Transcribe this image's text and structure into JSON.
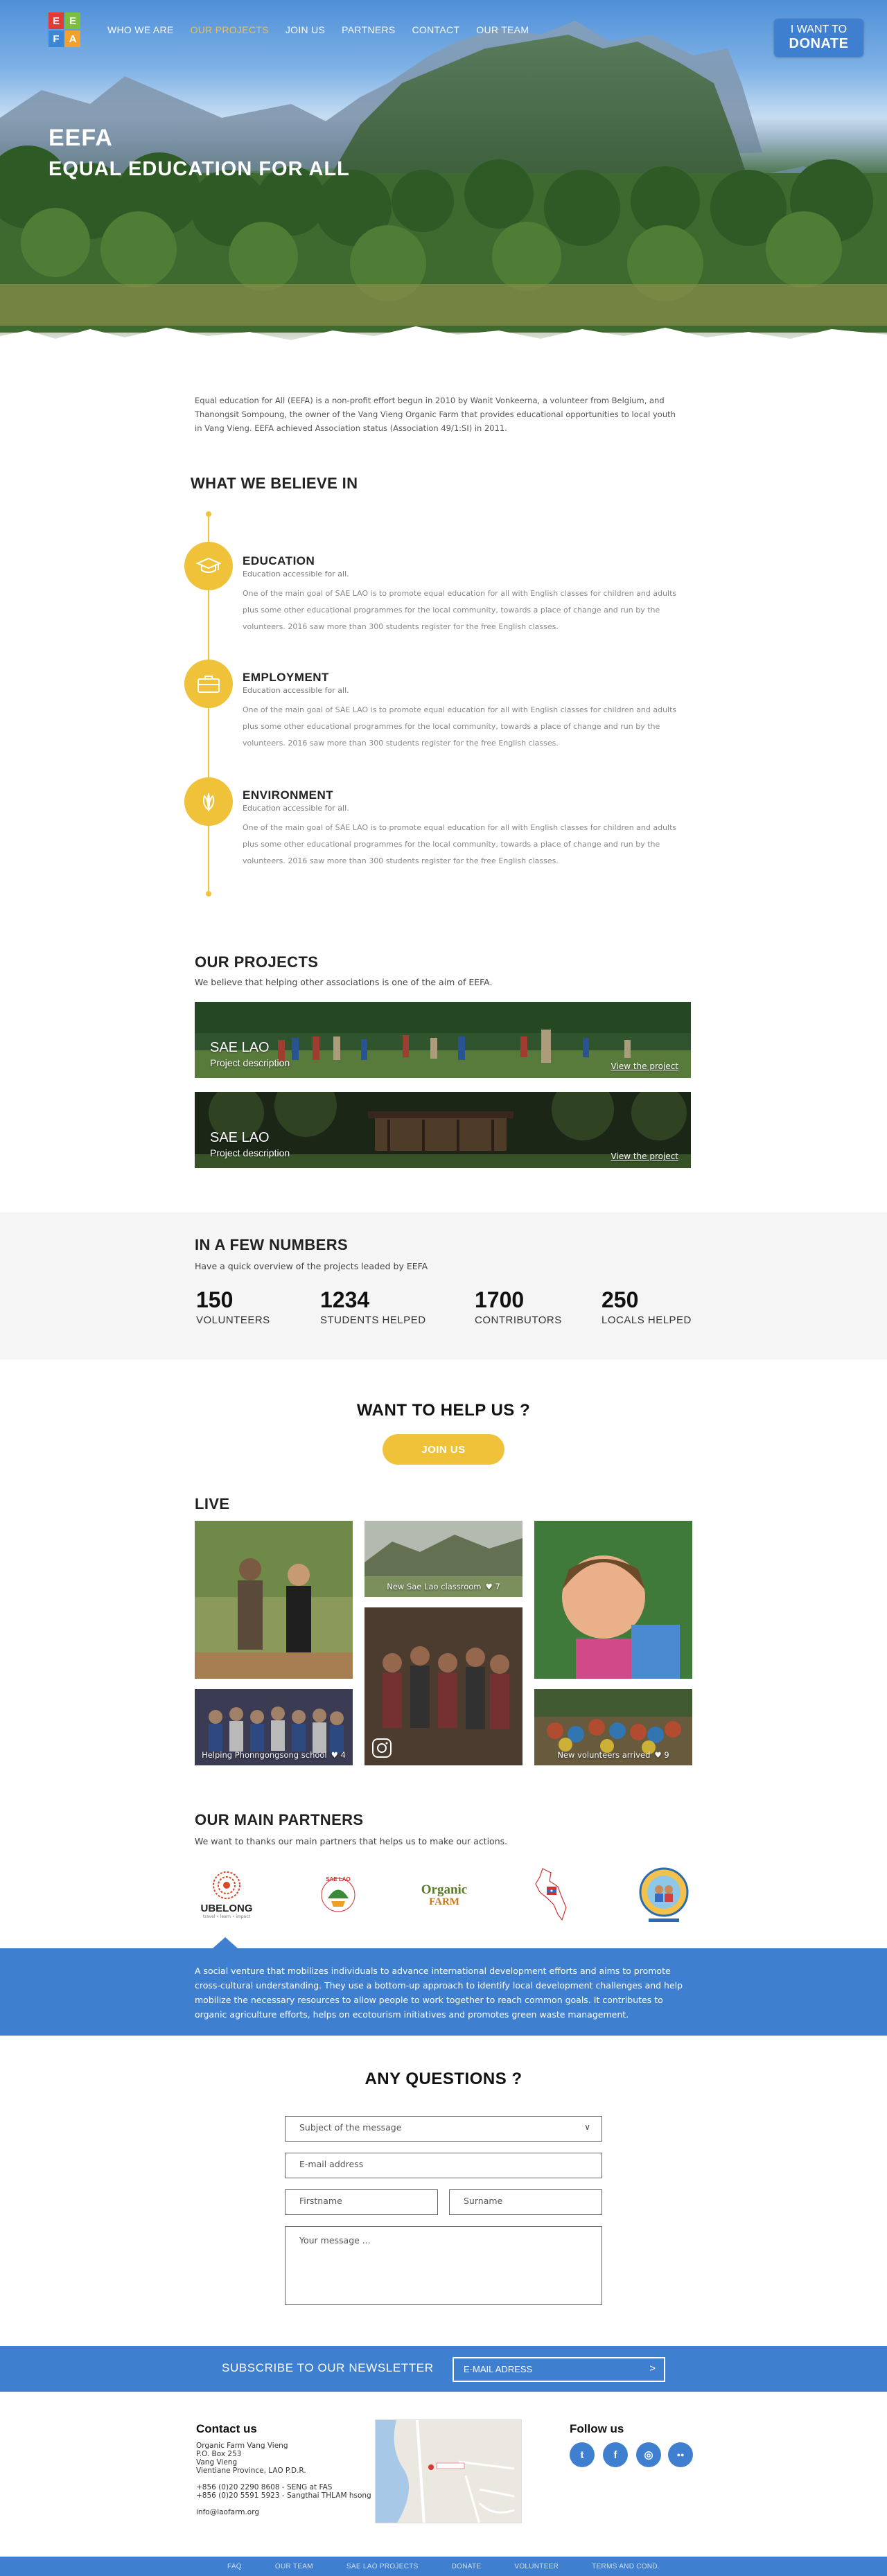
{
  "logo": {
    "letters": [
      "E",
      "E",
      "F",
      "A"
    ],
    "colors": [
      "#e23b36",
      "#7bbf3d",
      "#3b86d6",
      "#f2a12f"
    ]
  },
  "nav": {
    "items": [
      "WHO WE ARE",
      "OUR PROJECTS",
      "JOIN US",
      "PARTNERS",
      "CONTACT",
      "OUR TEAM"
    ],
    "active": "OUR PROJECTS"
  },
  "donate": {
    "line1": "I WANT TO",
    "line2": "DONATE"
  },
  "hero": {
    "title": "EEFA",
    "subtitle": "EQUAL EDUCATION FOR ALL"
  },
  "intro": "Equal education for All (EEFA) is a non-profit effort begun in 2010 by Wanit Vonkeerna, a volunteer from Belgium, and Thanongsit Sompoung, the owner of the Vang Vieng Organic Farm that provides educational opportunities to local youth in Vang Vieng. EEFA achieved Association status (Association 49/1:SI) in 2011.",
  "beliefs": {
    "heading": "WHAT WE BELIEVE IN",
    "items": [
      {
        "icon": "graduation-cap-icon",
        "title": "EDUCATION",
        "sub": "Education accessible for all.",
        "text": "One of the main goal of SAE LAO is to promote equal education for all with English classes for children and adults plus some other educational programmes for the local community, towards a place of change and run by the volunteers. 2016 saw more than 300 students register for the free English classes."
      },
      {
        "icon": "briefcase-icon",
        "title": "EMPLOYMENT",
        "sub": "Education accessible for all.",
        "text": "One of the main goal of SAE LAO is to promote equal education for all with English classes for children and adults plus some other educational programmes for the local community, towards a place of change and run by the volunteers. 2016 saw more than 300 students register for the free English classes."
      },
      {
        "icon": "leaf-icon",
        "title": "ENVIRONMENT",
        "sub": "Education accessible for all.",
        "text": "One of the main goal of SAE LAO is to promote equal education for all with English classes for children and adults plus some other educational programmes for the local community, towards a place of change and run by the volunteers. 2016 saw more than 300 students register for the free English classes."
      }
    ]
  },
  "projects": {
    "heading": "OUR PROJECTS",
    "sub": "We believe that helping other associations is one of the aim of EEFA.",
    "items": [
      {
        "title": "SAE LAO",
        "desc": "Project description",
        "link": "View the project"
      },
      {
        "title": "SAE LAO",
        "desc": "Project description",
        "link": "View the project"
      }
    ]
  },
  "numbers": {
    "heading": "IN A FEW NUMBERS",
    "sub": "Have a quick overview of the projects leaded by EEFA",
    "stats": [
      {
        "value": "150",
        "label": "VOLUNTEERS"
      },
      {
        "value": "1234",
        "label": "STUDENTS HELPED"
      },
      {
        "value": "1700",
        "label": "CONTRIBUTORS"
      },
      {
        "value": "250",
        "label": "LOCALS HELPED"
      }
    ]
  },
  "help": {
    "heading": "WANT TO HELP US ?",
    "button": "JOIN US"
  },
  "live": {
    "heading": "LIVE",
    "tiles": [
      {
        "caption": ""
      },
      {
        "caption": "New Sae Lao classroom",
        "heart": "7"
      },
      {
        "caption": ""
      },
      {
        "caption": "Helping Phonngongsong school",
        "heart": "4"
      },
      {
        "caption": ""
      },
      {
        "caption": "New volunteers arrived",
        "heart": "9"
      }
    ]
  },
  "partners": {
    "heading": "OUR MAIN PARTNERS",
    "sub": "We want to thanks our main partners that helps us to make our actions.",
    "logos": [
      "UBELONG",
      "SAE LAO Project",
      "Organic Farm",
      "Laos map",
      "Vang Vieng School"
    ],
    "ubelong_tag": "travel • learn • impact",
    "saelao_text": "SAE LAO",
    "organic_text": "Organic",
    "farm_text": "FARM",
    "banner": "A social venture that mobilizes individuals to advance international development efforts and aims to promote cross-cultural understanding. They use a bottom-up approach to identify local development challenges and help mobilize the necessary resources to allow people to work together to reach common goals. It contributes to organic agriculture efforts, helps on ecotourism initiatives and promotes green waste management."
  },
  "questions": {
    "heading": "ANY QUESTIONS ?",
    "subject": "Subject of the message",
    "email": "E-mail address",
    "firstname": "Firstname",
    "surname": "Surname",
    "message": "Your message ..."
  },
  "newsletter": {
    "label": "SUBSCRIBE TO OUR NEWSLETTER",
    "placeholder": "E-MAIL ADRESS",
    "arrow": ">"
  },
  "contact": {
    "heading": "Contact us",
    "lines": [
      "Organic Farm Vang Vieng",
      "P.O. Box 253",
      "Vang Vieng",
      "Vientiane Province, LAO P.D.R.",
      "",
      "+856 (0)20 2290 8608 - SENG at FAS",
      "+856 (0)20 5591 5923 - Sangthai THLAM hsong",
      "",
      "info@laofarm.org"
    ]
  },
  "follow": {
    "heading": "Follow us",
    "icons": [
      "twitter-icon",
      "facebook-icon",
      "instagram-icon",
      "flickr-icon"
    ],
    "glyphs": [
      "t",
      "f",
      "◎",
      "●●"
    ]
  },
  "footer": [
    "FAQ",
    "OUR TEAM",
    "SAE LAO PROJECTS",
    "DONATE",
    "VOLUNTEER",
    "TERMS AND COND."
  ]
}
